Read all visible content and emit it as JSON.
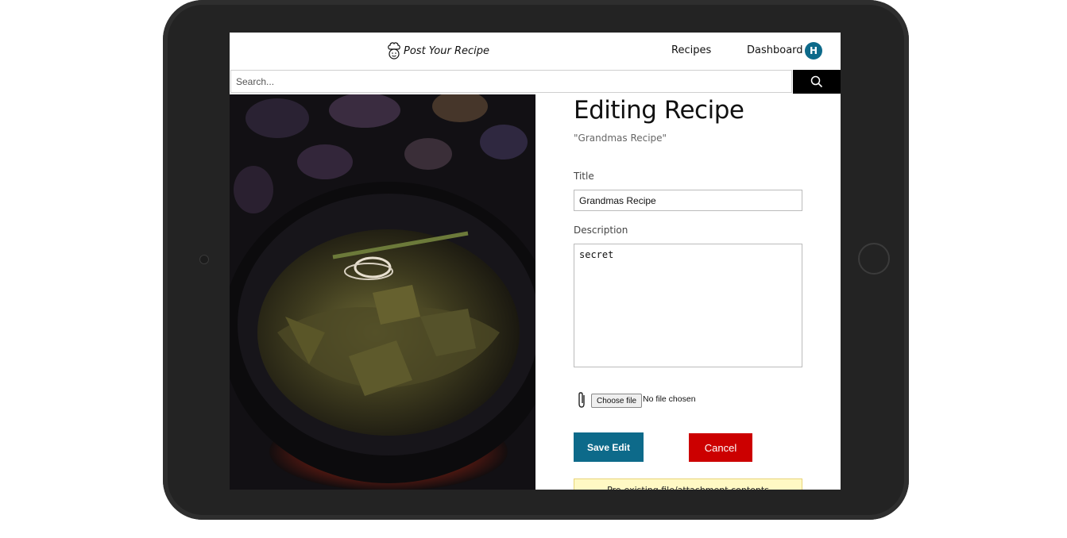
{
  "brand": {
    "name": "Post Your Recipe",
    "logo_icon": "chef-icon"
  },
  "nav": {
    "recipes_label": "Recipes",
    "dashboard_label": "Dashboard",
    "avatar_initial": "H"
  },
  "search": {
    "placeholder": "Search...",
    "icon": "search-icon"
  },
  "page": {
    "heading": "Editing Recipe",
    "subtitle": "\"Grandmas Recipe\""
  },
  "form": {
    "title_label": "Title",
    "title_value": "Grandmas Recipe",
    "description_label": "Description",
    "description_value": "secret",
    "file_button_label": "Choose file",
    "file_status": "No file chosen",
    "save_label": "Save Edit",
    "cancel_label": "Cancel",
    "notice_text": "Pre-existing file/attachment contents"
  },
  "colors": {
    "primary": "#0d6a8a",
    "danger": "#cc0000",
    "notice_bg": "#fff9c4"
  }
}
